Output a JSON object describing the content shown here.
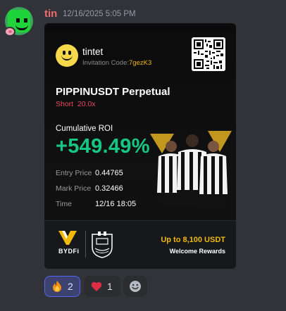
{
  "message": {
    "author": "tin",
    "timestamp": "12/16/2025 5:05 PM"
  },
  "card": {
    "user_handle": "tintet",
    "invitation_label": "Invitation Code:",
    "invitation_code": "7gezK3",
    "pair": "PIPPINUSDT Perpetual",
    "side": "Short",
    "leverage": "20.0x",
    "roi_label": "Cumulative ROI",
    "roi_value": "+549.49%",
    "rows": [
      {
        "label": "Entry Price",
        "value": "0.44765"
      },
      {
        "label": "Mark Price",
        "value": "0.32466"
      },
      {
        "label": "Time",
        "value": "12/16 18:05"
      }
    ],
    "footer": {
      "brand": "BYDFi",
      "promo_title": "Up to 8,100 USDT",
      "promo_sub": "Welcome Rewards"
    },
    "colors": {
      "roi": "#16c784",
      "short": "#e84a5f",
      "accent": "#f0b90b"
    }
  },
  "reactions": [
    {
      "emoji": "fire-icon",
      "count": "2",
      "active": true
    },
    {
      "emoji": "heart-icon",
      "count": "1",
      "active": false
    }
  ],
  "add_reaction_icon": "add-reaction-smiley-icon"
}
